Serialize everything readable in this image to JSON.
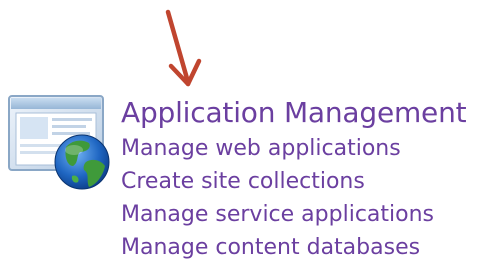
{
  "section": {
    "title": "Application Management",
    "links": [
      "Manage web applications",
      "Create site collections",
      "Manage service applications",
      "Manage content databases"
    ]
  },
  "colors": {
    "link": "#6b3fa0",
    "arrow": "#c0452f"
  },
  "icons": {
    "section_icon": "application-window-globe-icon",
    "annotation": "arrow-down-icon"
  }
}
